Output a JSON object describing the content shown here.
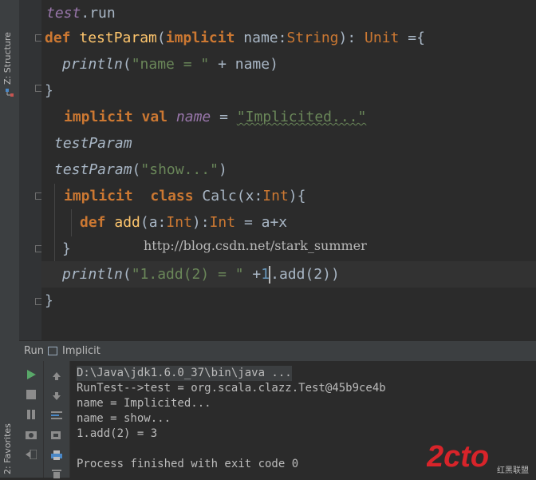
{
  "left_strip": {
    "structure_tab": "Z: Structure",
    "favorites_tab": "2: Favorites"
  },
  "code": {
    "line1": {
      "obj": "test",
      "dot": ".",
      "method": "run"
    },
    "line2": {
      "kw_def": "def",
      "fn_name": "testParam",
      "paren_open": "(",
      "kw_implicit": "implicit",
      "param": " name",
      "colon": ":",
      "ptype": "String",
      "paren_close": "): ",
      "rtype": "Unit",
      "tail": " ={"
    },
    "line3": {
      "fn": "println",
      "open": "(",
      "str": "\"name = \"",
      "rest": " + name)"
    },
    "line4": {
      "text": "}"
    },
    "line5": {
      "kw_implicit": "implicit",
      "kw_val": "val",
      "var": "name",
      "eq": " = ",
      "str": "\"Implicited...\""
    },
    "line6": {
      "text": "testParam"
    },
    "line7": {
      "fn": "testParam",
      "open": "(",
      "str": "\"show...\"",
      "close": ")"
    },
    "line8": {
      "kw_implicit": "implicit",
      "kw_class": "class",
      "cls": " Calc",
      "open": "(x:",
      "type": "Int",
      "close": "){"
    },
    "line9": {
      "kw_def": "def",
      "fn": "add",
      "open": "(a:",
      "type": "Int",
      "mid": "):",
      "rtype": "Int",
      "rest": " = a+x"
    },
    "line10": {
      "text": "}"
    },
    "line11": {
      "fn": "println",
      "open": "(",
      "str": "\"1.add(2) = \"",
      "plus": " +",
      "num": "1",
      "rest": ".add(2))"
    },
    "line12": {
      "text": "}"
    }
  },
  "watermark": "http://blog.csdn.net/stark_summer",
  "run_panel": {
    "label": "Run",
    "config_name": "Implicit",
    "output": [
      "D:\\Java\\jdk1.6.0_37\\bin\\java ...",
      "RunTest-->test = org.scala.clazz.Test@45b9ce4b",
      "name = Implicited...",
      "name = show...",
      "1.add(2) = 3",
      "",
      "Process finished with exit code 0"
    ],
    "icons_col1": [
      "run-icon",
      "stop-icon",
      "pause-icon",
      "camera-icon",
      "exit-icon"
    ],
    "icons_col2": [
      "up-arrow-icon",
      "down-arrow-icon",
      "wrap-icon",
      "export-icon",
      "print-icon",
      "trash-icon"
    ]
  },
  "logo": {
    "brand": "2cto",
    "sub": "红黑联盟"
  },
  "colors": {
    "bg": "#2b2b2b",
    "keyword": "#cc7832",
    "function": "#ffc66d",
    "string": "#6a8759",
    "number": "#6897bb",
    "field": "#9876aa",
    "text": "#a9b7c6",
    "panel": "#3c3f41",
    "logo_red": "#d8242a"
  }
}
